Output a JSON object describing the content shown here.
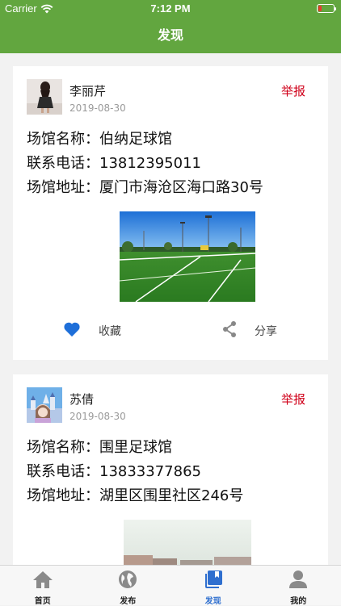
{
  "status": {
    "carrier": "Carrier",
    "time": "7:12 PM"
  },
  "header": {
    "title": "发现"
  },
  "posts": [
    {
      "user": "李丽芹",
      "date": "2019-08-30",
      "report": "举报",
      "venue_line": "场馆名称：伯纳足球馆",
      "phone_line": "联系电话：13812395011",
      "address_line": "场馆地址：厦门市海沧区海口路30号",
      "favorite_label": "收藏",
      "share_label": "分享"
    },
    {
      "user": "苏倩",
      "date": "2019-08-30",
      "report": "举报",
      "venue_line": "场馆名称：围里足球馆",
      "phone_line": "联系电话：13833377865",
      "address_line": "场馆地址：湖里区围里社区246号"
    }
  ],
  "tabs": [
    {
      "label": "首页",
      "icon": "home-icon"
    },
    {
      "label": "发布",
      "icon": "globe-icon"
    },
    {
      "label": "发现",
      "icon": "book-icon",
      "active": true
    },
    {
      "label": "我的",
      "icon": "person-icon"
    }
  ],
  "colors": {
    "brand": "#62a63f",
    "report": "#d0021b",
    "active_tab": "#2f6fcf",
    "heart": "#1e6fd9"
  }
}
